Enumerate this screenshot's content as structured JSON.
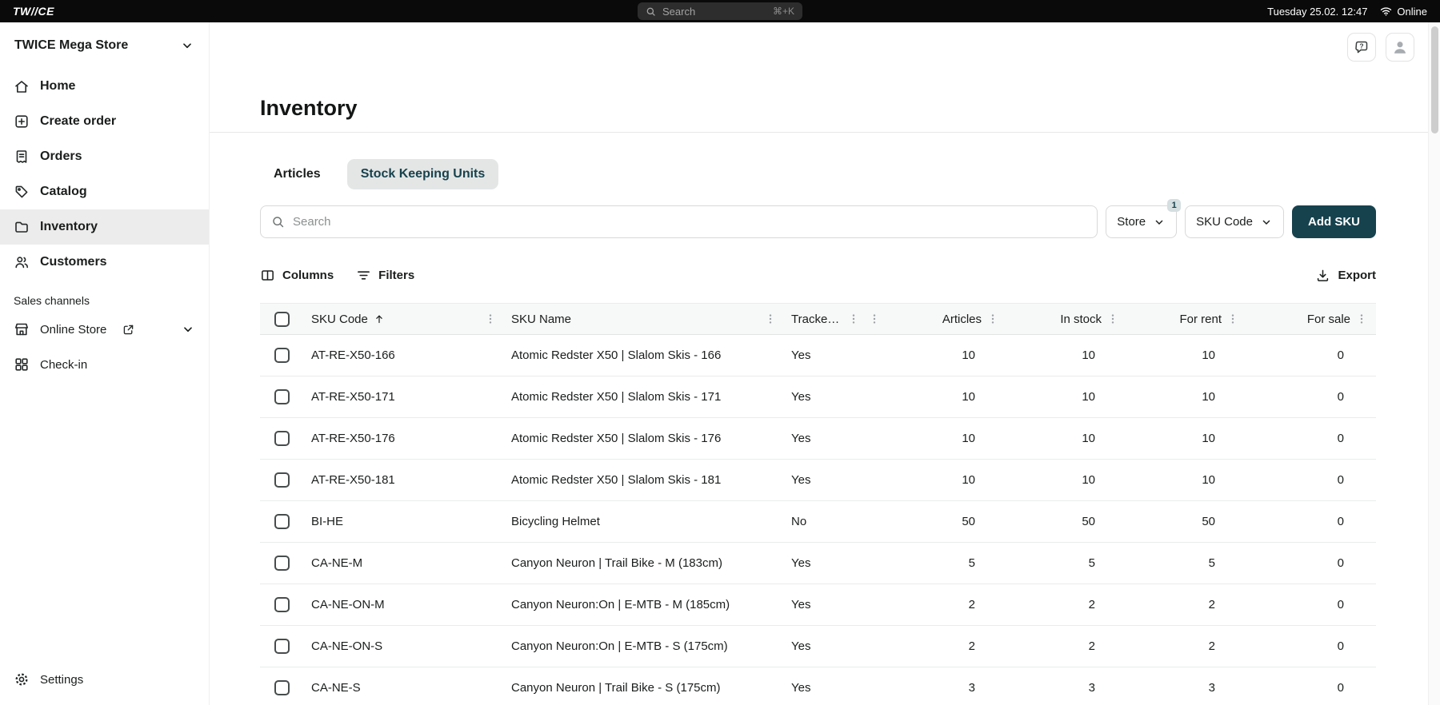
{
  "topbar": {
    "logo": "TW//CE",
    "search": {
      "placeholder": "Search",
      "shortcut": "⌘+K"
    },
    "datetime": "Tuesday 25.02. 12:47",
    "status": "Online"
  },
  "sidebar": {
    "store_name": "TWICE Mega Store",
    "items": [
      {
        "label": "Home"
      },
      {
        "label": "Create order"
      },
      {
        "label": "Orders"
      },
      {
        "label": "Catalog"
      },
      {
        "label": "Inventory"
      },
      {
        "label": "Customers"
      }
    ],
    "sales_channels": {
      "label": "Sales channels",
      "items": [
        {
          "label": "Online Store"
        },
        {
          "label": "Check-in"
        }
      ]
    },
    "settings_label": "Settings"
  },
  "header": {
    "title": "Inventory"
  },
  "tabs": {
    "articles": "Articles",
    "skus": "Stock Keeping Units"
  },
  "controls": {
    "search_placeholder": "Search",
    "store": {
      "label": "Store",
      "badge": "1"
    },
    "sku_code": {
      "label": "SKU Code"
    },
    "add_sku": "Add SKU",
    "columns": "Columns",
    "filters": "Filters",
    "export": "Export"
  },
  "table": {
    "headers": {
      "sku_code": "SKU Code",
      "sku_name": "SKU Name",
      "tracked": "Tracke…",
      "articles": "Articles",
      "in_stock": "In stock",
      "for_rent": "For rent",
      "for_sale": "For sale"
    },
    "rows": [
      {
        "sku_code": "AT-RE-X50-166",
        "sku_name": "Atomic Redster X50 | Slalom Skis - 166",
        "tracked": "Yes",
        "articles": "10",
        "in_stock": "10",
        "for_rent": "10",
        "for_sale": "0"
      },
      {
        "sku_code": "AT-RE-X50-171",
        "sku_name": "Atomic Redster X50 | Slalom Skis - 171",
        "tracked": "Yes",
        "articles": "10",
        "in_stock": "10",
        "for_rent": "10",
        "for_sale": "0"
      },
      {
        "sku_code": "AT-RE-X50-176",
        "sku_name": "Atomic Redster X50 | Slalom Skis - 176",
        "tracked": "Yes",
        "articles": "10",
        "in_stock": "10",
        "for_rent": "10",
        "for_sale": "0"
      },
      {
        "sku_code": "AT-RE-X50-181",
        "sku_name": "Atomic Redster X50 | Slalom Skis - 181",
        "tracked": "Yes",
        "articles": "10",
        "in_stock": "10",
        "for_rent": "10",
        "for_sale": "0"
      },
      {
        "sku_code": "BI-HE",
        "sku_name": "Bicycling Helmet",
        "tracked": "No",
        "articles": "50",
        "in_stock": "50",
        "for_rent": "50",
        "for_sale": "0"
      },
      {
        "sku_code": "CA-NE-M",
        "sku_name": "Canyon Neuron | Trail Bike - M (183cm)",
        "tracked": "Yes",
        "articles": "5",
        "in_stock": "5",
        "for_rent": "5",
        "for_sale": "0"
      },
      {
        "sku_code": "CA-NE-ON-M",
        "sku_name": "Canyon Neuron:On | E-MTB - M (185cm)",
        "tracked": "Yes",
        "articles": "2",
        "in_stock": "2",
        "for_rent": "2",
        "for_sale": "0"
      },
      {
        "sku_code": "CA-NE-ON-S",
        "sku_name": "Canyon Neuron:On | E-MTB - S (175cm)",
        "tracked": "Yes",
        "articles": "2",
        "in_stock": "2",
        "for_rent": "2",
        "for_sale": "0"
      },
      {
        "sku_code": "CA-NE-S",
        "sku_name": "Canyon Neuron | Trail Bike - S (175cm)",
        "tracked": "Yes",
        "articles": "3",
        "in_stock": "3",
        "for_rent": "3",
        "for_sale": "0"
      }
    ]
  }
}
